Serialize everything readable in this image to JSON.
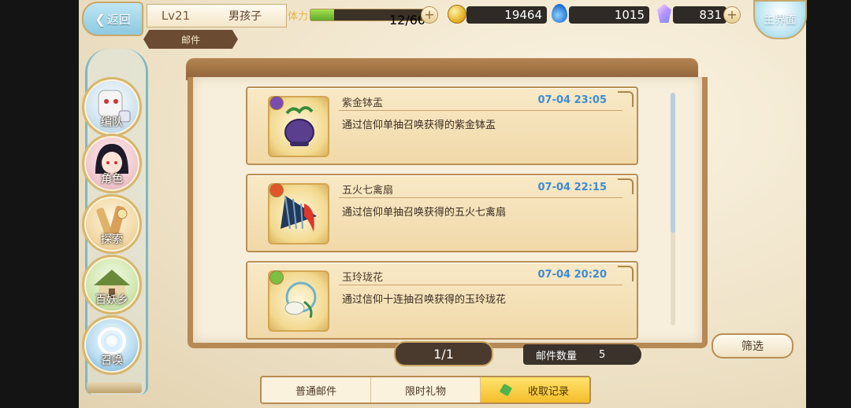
{
  "topbar": {
    "back_label": "返回",
    "level": "Lv21",
    "player_name": "男孩子",
    "section_tab": "邮件",
    "stamina_label": "体力",
    "stamina_value": "12/60",
    "stamina_fraction": 0.2,
    "gold": "19464",
    "gems": "1015",
    "crystals": "831",
    "main_label": "主界面"
  },
  "nav": [
    {
      "label": "编队",
      "icon": "team-icon"
    },
    {
      "label": "角色",
      "icon": "character-icon"
    },
    {
      "label": "探索",
      "icon": "explore-icon"
    },
    {
      "label": "百妖乡",
      "icon": "village-icon"
    },
    {
      "label": "召唤",
      "icon": "summon-icon"
    }
  ],
  "mails": [
    {
      "title": "紫金钵盂",
      "time": "07-04 23:05",
      "desc": "通过信仰单抽召唤获得的紫金钵盂",
      "badge_color": "#7a4bb3"
    },
    {
      "title": "五火七禽扇",
      "time": "07-04 22:15",
      "desc": "通过信仰单抽召唤获得的五火七禽扇",
      "badge_color": "#e0562a"
    },
    {
      "title": "玉玲珑花",
      "time": "07-04 20:20",
      "desc": "通过信仰十连抽召唤获得的玉玲珑花",
      "badge_color": "#7cc043"
    }
  ],
  "pager": "1/1",
  "mail_count_label": "邮件数量",
  "mail_count": "5",
  "filter_label": "筛选",
  "tabs": [
    "普通邮件",
    "限时礼物",
    "收取记录"
  ]
}
